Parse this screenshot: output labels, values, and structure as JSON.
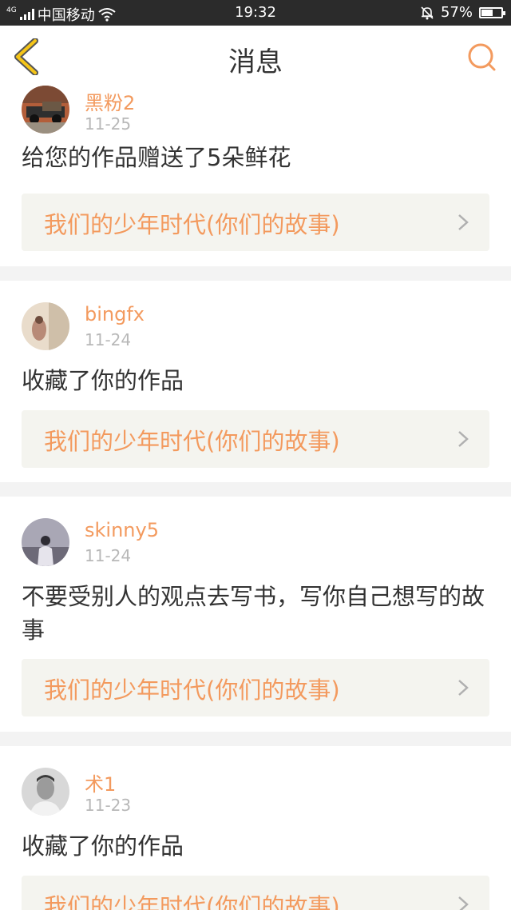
{
  "statusbar": {
    "network": "4G",
    "carrier": "中国移动",
    "time": "19:32",
    "battery": "57%",
    "battery_level": 0.57
  },
  "nav": {
    "title": "消息",
    "back_icon": "chevron-left-icon",
    "search_icon": "search-icon"
  },
  "colors": {
    "accent": "#f39a5e",
    "back_arrow": "#f5c518",
    "work_bg": "#f4f4ef"
  },
  "messages": [
    {
      "user": "黑粉2",
      "date": "11-25",
      "text": "给您的作品赠送了5朵鲜花",
      "work": "我们的少年时代(你们的故事)"
    },
    {
      "user": "bingfx",
      "date": "11-24",
      "text": "收藏了你的作品",
      "work": "我们的少年时代(你们的故事)"
    },
    {
      "user": "skinny5",
      "date": "11-24",
      "text": "不要受别人的观点去写书，写你自己想写的故事",
      "work": "我们的少年时代(你们的故事)"
    },
    {
      "user": "术1",
      "date": "11-23",
      "text": "收藏了你的作品",
      "work": "我们的少年时代(你们的故事)"
    }
  ]
}
